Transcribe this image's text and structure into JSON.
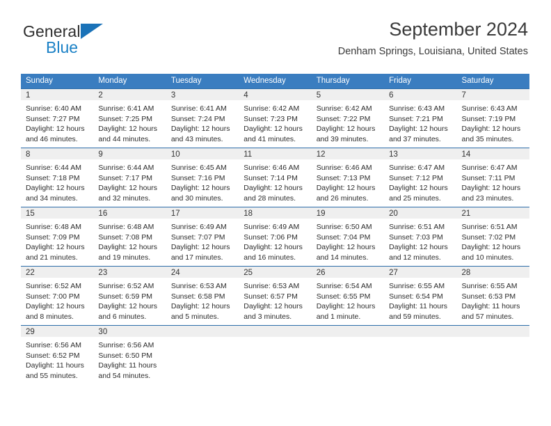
{
  "logo": {
    "primary_text": "General",
    "secondary_text": "Blue",
    "triangle_color": "#1a72b8",
    "secondary_color": "#1b81c6"
  },
  "header": {
    "title": "September 2024",
    "subtitle": "Denham Springs, Louisiana, United States"
  },
  "theme": {
    "header_row_bg": "#3a7dc0",
    "day_band_bg": "#efefef",
    "row_border": "#2b6ca8",
    "text": "#2b2b2b"
  },
  "weekdays": [
    "Sunday",
    "Monday",
    "Tuesday",
    "Wednesday",
    "Thursday",
    "Friday",
    "Saturday"
  ],
  "labels": {
    "sunrise": "Sunrise:",
    "sunset": "Sunset:",
    "daylight": "Daylight:"
  },
  "weeks": [
    [
      {
        "day": "1",
        "sunrise": "Sunrise: 6:40 AM",
        "sunset": "Sunset: 7:27 PM",
        "daylight_line1": "Daylight: 12 hours",
        "daylight_line2": "and 46 minutes."
      },
      {
        "day": "2",
        "sunrise": "Sunrise: 6:41 AM",
        "sunset": "Sunset: 7:25 PM",
        "daylight_line1": "Daylight: 12 hours",
        "daylight_line2": "and 44 minutes."
      },
      {
        "day": "3",
        "sunrise": "Sunrise: 6:41 AM",
        "sunset": "Sunset: 7:24 PM",
        "daylight_line1": "Daylight: 12 hours",
        "daylight_line2": "and 43 minutes."
      },
      {
        "day": "4",
        "sunrise": "Sunrise: 6:42 AM",
        "sunset": "Sunset: 7:23 PM",
        "daylight_line1": "Daylight: 12 hours",
        "daylight_line2": "and 41 minutes."
      },
      {
        "day": "5",
        "sunrise": "Sunrise: 6:42 AM",
        "sunset": "Sunset: 7:22 PM",
        "daylight_line1": "Daylight: 12 hours",
        "daylight_line2": "and 39 minutes."
      },
      {
        "day": "6",
        "sunrise": "Sunrise: 6:43 AM",
        "sunset": "Sunset: 7:21 PM",
        "daylight_line1": "Daylight: 12 hours",
        "daylight_line2": "and 37 minutes."
      },
      {
        "day": "7",
        "sunrise": "Sunrise: 6:43 AM",
        "sunset": "Sunset: 7:19 PM",
        "daylight_line1": "Daylight: 12 hours",
        "daylight_line2": "and 35 minutes."
      }
    ],
    [
      {
        "day": "8",
        "sunrise": "Sunrise: 6:44 AM",
        "sunset": "Sunset: 7:18 PM",
        "daylight_line1": "Daylight: 12 hours",
        "daylight_line2": "and 34 minutes."
      },
      {
        "day": "9",
        "sunrise": "Sunrise: 6:44 AM",
        "sunset": "Sunset: 7:17 PM",
        "daylight_line1": "Daylight: 12 hours",
        "daylight_line2": "and 32 minutes."
      },
      {
        "day": "10",
        "sunrise": "Sunrise: 6:45 AM",
        "sunset": "Sunset: 7:16 PM",
        "daylight_line1": "Daylight: 12 hours",
        "daylight_line2": "and 30 minutes."
      },
      {
        "day": "11",
        "sunrise": "Sunrise: 6:46 AM",
        "sunset": "Sunset: 7:14 PM",
        "daylight_line1": "Daylight: 12 hours",
        "daylight_line2": "and 28 minutes."
      },
      {
        "day": "12",
        "sunrise": "Sunrise: 6:46 AM",
        "sunset": "Sunset: 7:13 PM",
        "daylight_line1": "Daylight: 12 hours",
        "daylight_line2": "and 26 minutes."
      },
      {
        "day": "13",
        "sunrise": "Sunrise: 6:47 AM",
        "sunset": "Sunset: 7:12 PM",
        "daylight_line1": "Daylight: 12 hours",
        "daylight_line2": "and 25 minutes."
      },
      {
        "day": "14",
        "sunrise": "Sunrise: 6:47 AM",
        "sunset": "Sunset: 7:11 PM",
        "daylight_line1": "Daylight: 12 hours",
        "daylight_line2": "and 23 minutes."
      }
    ],
    [
      {
        "day": "15",
        "sunrise": "Sunrise: 6:48 AM",
        "sunset": "Sunset: 7:09 PM",
        "daylight_line1": "Daylight: 12 hours",
        "daylight_line2": "and 21 minutes."
      },
      {
        "day": "16",
        "sunrise": "Sunrise: 6:48 AM",
        "sunset": "Sunset: 7:08 PM",
        "daylight_line1": "Daylight: 12 hours",
        "daylight_line2": "and 19 minutes."
      },
      {
        "day": "17",
        "sunrise": "Sunrise: 6:49 AM",
        "sunset": "Sunset: 7:07 PM",
        "daylight_line1": "Daylight: 12 hours",
        "daylight_line2": "and 17 minutes."
      },
      {
        "day": "18",
        "sunrise": "Sunrise: 6:49 AM",
        "sunset": "Sunset: 7:06 PM",
        "daylight_line1": "Daylight: 12 hours",
        "daylight_line2": "and 16 minutes."
      },
      {
        "day": "19",
        "sunrise": "Sunrise: 6:50 AM",
        "sunset": "Sunset: 7:04 PM",
        "daylight_line1": "Daylight: 12 hours",
        "daylight_line2": "and 14 minutes."
      },
      {
        "day": "20",
        "sunrise": "Sunrise: 6:51 AM",
        "sunset": "Sunset: 7:03 PM",
        "daylight_line1": "Daylight: 12 hours",
        "daylight_line2": "and 12 minutes."
      },
      {
        "day": "21",
        "sunrise": "Sunrise: 6:51 AM",
        "sunset": "Sunset: 7:02 PM",
        "daylight_line1": "Daylight: 12 hours",
        "daylight_line2": "and 10 minutes."
      }
    ],
    [
      {
        "day": "22",
        "sunrise": "Sunrise: 6:52 AM",
        "sunset": "Sunset: 7:00 PM",
        "daylight_line1": "Daylight: 12 hours",
        "daylight_line2": "and 8 minutes."
      },
      {
        "day": "23",
        "sunrise": "Sunrise: 6:52 AM",
        "sunset": "Sunset: 6:59 PM",
        "daylight_line1": "Daylight: 12 hours",
        "daylight_line2": "and 6 minutes."
      },
      {
        "day": "24",
        "sunrise": "Sunrise: 6:53 AM",
        "sunset": "Sunset: 6:58 PM",
        "daylight_line1": "Daylight: 12 hours",
        "daylight_line2": "and 5 minutes."
      },
      {
        "day": "25",
        "sunrise": "Sunrise: 6:53 AM",
        "sunset": "Sunset: 6:57 PM",
        "daylight_line1": "Daylight: 12 hours",
        "daylight_line2": "and 3 minutes."
      },
      {
        "day": "26",
        "sunrise": "Sunrise: 6:54 AM",
        "sunset": "Sunset: 6:55 PM",
        "daylight_line1": "Daylight: 12 hours",
        "daylight_line2": "and 1 minute."
      },
      {
        "day": "27",
        "sunrise": "Sunrise: 6:55 AM",
        "sunset": "Sunset: 6:54 PM",
        "daylight_line1": "Daylight: 11 hours",
        "daylight_line2": "and 59 minutes."
      },
      {
        "day": "28",
        "sunrise": "Sunrise: 6:55 AM",
        "sunset": "Sunset: 6:53 PM",
        "daylight_line1": "Daylight: 11 hours",
        "daylight_line2": "and 57 minutes."
      }
    ],
    [
      {
        "day": "29",
        "sunrise": "Sunrise: 6:56 AM",
        "sunset": "Sunset: 6:52 PM",
        "daylight_line1": "Daylight: 11 hours",
        "daylight_line2": "and 55 minutes."
      },
      {
        "day": "30",
        "sunrise": "Sunrise: 6:56 AM",
        "sunset": "Sunset: 6:50 PM",
        "daylight_line1": "Daylight: 11 hours",
        "daylight_line2": "and 54 minutes."
      },
      {
        "day": "",
        "sunrise": "",
        "sunset": "",
        "daylight_line1": "",
        "daylight_line2": ""
      },
      {
        "day": "",
        "sunrise": "",
        "sunset": "",
        "daylight_line1": "",
        "daylight_line2": ""
      },
      {
        "day": "",
        "sunrise": "",
        "sunset": "",
        "daylight_line1": "",
        "daylight_line2": ""
      },
      {
        "day": "",
        "sunrise": "",
        "sunset": "",
        "daylight_line1": "",
        "daylight_line2": ""
      },
      {
        "day": "",
        "sunrise": "",
        "sunset": "",
        "daylight_line1": "",
        "daylight_line2": ""
      }
    ]
  ]
}
